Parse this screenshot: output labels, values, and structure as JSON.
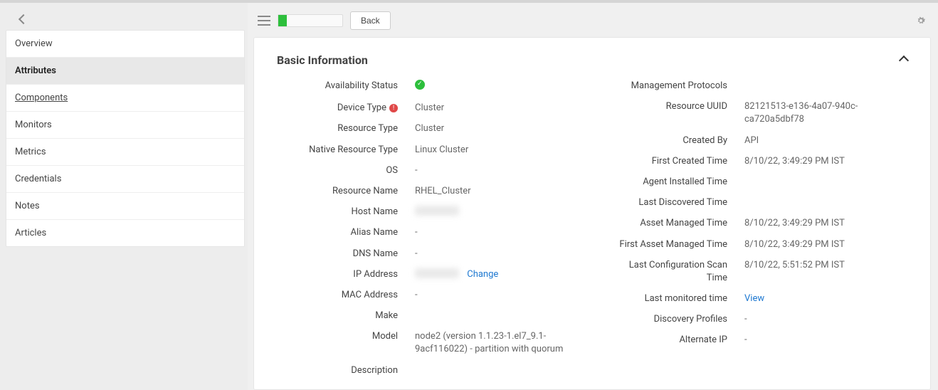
{
  "sidebar": {
    "items": [
      {
        "label": "Overview"
      },
      {
        "label": "Attributes"
      },
      {
        "label": "Components"
      },
      {
        "label": "Monitors"
      },
      {
        "label": "Metrics"
      },
      {
        "label": "Credentials"
      },
      {
        "label": "Notes"
      },
      {
        "label": "Articles"
      }
    ]
  },
  "toolbar": {
    "back_label": "Back"
  },
  "panel": {
    "title": "Basic Information",
    "change_link": "Change",
    "view_link": "View"
  },
  "left": {
    "availability_status_label": "Availability Status",
    "device_type_label": "Device Type",
    "device_type_value": "Cluster",
    "resource_type_label": "Resource Type",
    "resource_type_value": "Cluster",
    "native_resource_type_label": "Native Resource Type",
    "native_resource_type_value": "Linux Cluster",
    "os_label": "OS",
    "os_value": "-",
    "resource_name_label": "Resource Name",
    "resource_name_value": "RHEL_Cluster",
    "host_name_label": "Host Name",
    "alias_name_label": "Alias Name",
    "alias_name_value": "-",
    "dns_name_label": "DNS Name",
    "dns_name_value": "-",
    "ip_address_label": "IP Address",
    "mac_address_label": "MAC Address",
    "mac_address_value": "-",
    "make_label": "Make",
    "make_value": "",
    "model_label": "Model",
    "model_value": "node2 (version 1.1.23-1.el7_9.1-9acf116022) - partition with quorum",
    "description_label": "Description"
  },
  "right": {
    "management_protocols_label": "Management Protocols",
    "management_protocols_value": "",
    "resource_uuid_label": "Resource UUID",
    "resource_uuid_value": "82121513-e136-4a07-940c-ca720a5dbf78",
    "created_by_label": "Created By",
    "created_by_value": "API",
    "first_created_time_label": "First Created Time",
    "first_created_time_value": "8/10/22, 3:49:29 PM IST",
    "agent_installed_time_label": "Agent Installed Time",
    "agent_installed_time_value": "",
    "last_discovered_time_label": "Last Discovered Time",
    "last_discovered_time_value": "",
    "asset_managed_time_label": "Asset Managed Time",
    "asset_managed_time_value": "8/10/22, 3:49:29 PM IST",
    "first_asset_managed_time_label": "First Asset Managed Time",
    "first_asset_managed_time_value": "8/10/22, 3:49:29 PM IST",
    "last_config_scan_time_label": "Last Configuration Scan Time",
    "last_config_scan_time_value": "8/10/22, 5:51:52 PM IST",
    "last_monitored_time_label": "Last monitored time",
    "discovery_profiles_label": "Discovery Profiles",
    "discovery_profiles_value": "-",
    "alternate_ip_label": "Alternate IP",
    "alternate_ip_value": "-"
  }
}
